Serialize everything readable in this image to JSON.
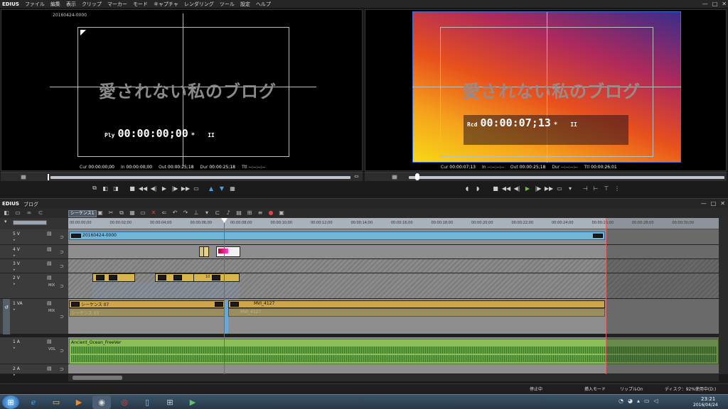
{
  "app": {
    "logo": "EDIUS"
  },
  "menu": [
    "ファイル",
    "編集",
    "表示",
    "クリップ",
    "マーカー",
    "モード",
    "キャプチャ",
    "レンダリング",
    "ツール",
    "設定",
    "ヘルプ"
  ],
  "window_controls": {
    "minimize": "—",
    "maximize": "□",
    "close": "✕"
  },
  "player": {
    "clip_name": "20160424-0000",
    "watermark": "愛されない私のブログ",
    "tc_label": "Ply",
    "timecode": "00:00:00;00",
    "tc_mark": "*",
    "pause": "II",
    "info": [
      {
        "k": "Cur",
        "v": "00:00:00;00"
      },
      {
        "k": "In",
        "v": "00:00:00;00"
      },
      {
        "k": "Out",
        "v": "00:00:25;18"
      },
      {
        "k": "Dur",
        "v": "00:00:25;18"
      },
      {
        "k": "Ttl",
        "v": "--:--:--:--"
      }
    ]
  },
  "recorder": {
    "watermark": "愛されない私のブログ",
    "tc_label": "Rcd",
    "timecode": "00:00:07;13",
    "tc_mark": "*",
    "pause": "II",
    "info": [
      {
        "k": "Cur",
        "v": "00:00:07;13"
      },
      {
        "k": "In",
        "v": "--:--:--:--"
      },
      {
        "k": "Out",
        "v": "00:00:25;18"
      },
      {
        "k": "Dur",
        "v": "--:--:--:--"
      },
      {
        "k": "Ttl",
        "v": "00:00:26;01"
      }
    ],
    "gradient": [
      "#3a2c8c",
      "#b02a5a",
      "#e8501c",
      "#f5a21c",
      "#f7d818"
    ]
  },
  "timeline": {
    "title_logo": "EDIUS",
    "project": "ブログ",
    "sequence_tab": "シーケンス1",
    "ruler": [
      "00:00:00;00",
      "00:00:02;00",
      "00:00:04;00",
      "00:00:06;00",
      "00:00:08;00",
      "00:00:10;00",
      "00:00:12;00",
      "00:00:14;00",
      "00:00:16;00",
      "00:00:18;00",
      "00:00:20;00",
      "00:00:22;00",
      "00:00:24;00",
      "00:00:26;00",
      "00:00:28;00",
      "00:00:30;00"
    ],
    "tracks": [
      {
        "name": "5 V",
        "label": ""
      },
      {
        "name": "4 V",
        "label": ""
      },
      {
        "name": "3 V",
        "label": ""
      },
      {
        "name": "2 V",
        "label": "MIX"
      },
      {
        "name": "1 VA",
        "label": "MIX"
      },
      {
        "name": "1 A",
        "label": "VOL"
      },
      {
        "name": "2 A",
        "label": ""
      }
    ],
    "clips": {
      "t1": "20160424-0000",
      "va_seq": "シーケンス 07",
      "va_seq_ghost": "シーケンス 03",
      "va_mvi": "MVI_4127",
      "va_mvi_ghost": "MVI_4127",
      "audio": "Ancient_Ocean_FreeVer",
      "clip_10": "10"
    }
  },
  "status": {
    "state": "停止中",
    "insert_mode": "挿入モード",
    "ripple": "リップルOn",
    "disk": "ディスク：92%使用中(D:)"
  },
  "taskbar": {
    "start": "⊞",
    "time": "23:21",
    "date": "2016/04/24",
    "colors": [
      "#1d6fd6",
      "#f5a300",
      "#1877f2",
      "#dd4b39"
    ]
  }
}
